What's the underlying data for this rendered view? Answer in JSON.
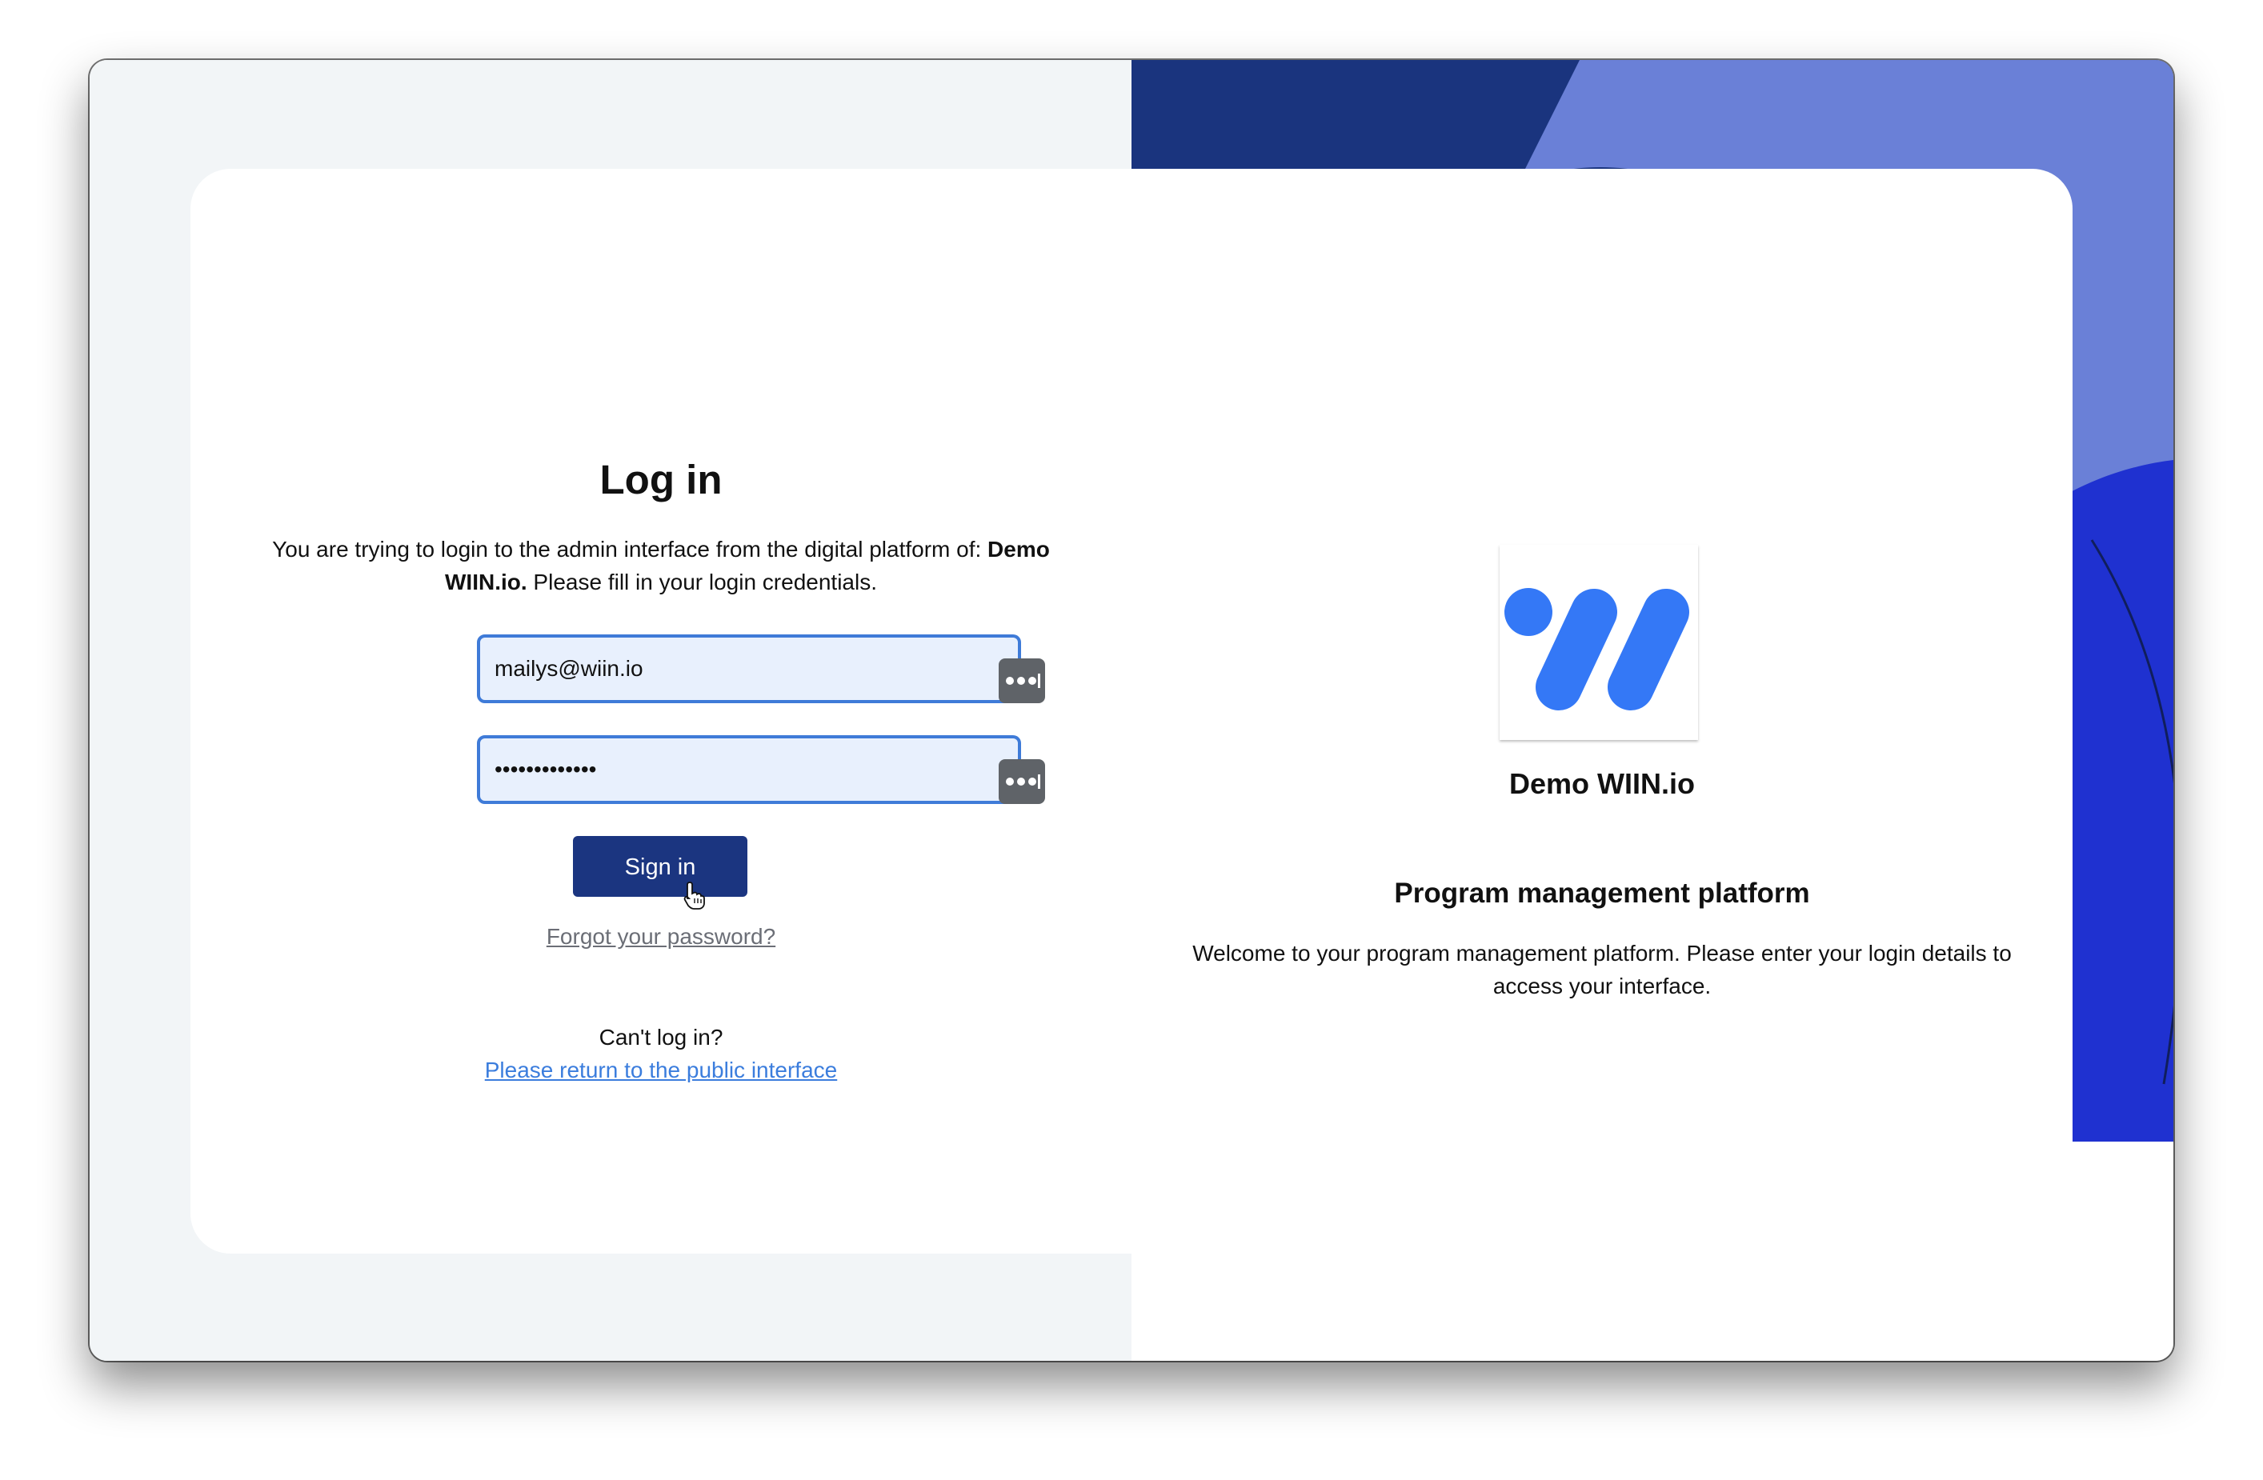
{
  "login": {
    "title": "Log in",
    "description_prefix": "You are trying to login to the admin interface from the digital platform of: ",
    "platform_name": "Demo WIIN.io.",
    "description_suffix": " Please fill in your login credentials.",
    "email_value": "mailys@wiin.io",
    "password_value": "•••••••••••••",
    "sign_in_label": "Sign in",
    "forgot_password_label": "Forgot your password?",
    "cant_login_label": "Can't log in?",
    "public_interface_link": "Please return to the public interface"
  },
  "branding": {
    "logo_icon": "wiin-logo-icon",
    "org_name": "Demo WIIN.io",
    "platform_title": "Program management platform",
    "platform_description": "Welcome to your program management platform. Please enter your login details to access your interface."
  },
  "colors": {
    "brand_navy": "#1b3580",
    "brand_blue": "#3478f6",
    "background_dark_blue": "#1a347e",
    "background_light_blue": "#6a80d7",
    "background_royal_blue": "#1f31d0",
    "field_border": "#3f7bd8",
    "field_background": "#e8f0fd",
    "link_blue": "#3b7ddd",
    "muted_link": "#6b6e76",
    "left_panel_background": "#f2f5f7"
  },
  "icons": {
    "password_manager": "password-manager-key-icon",
    "cursor": "hand-pointer-cursor-icon"
  }
}
